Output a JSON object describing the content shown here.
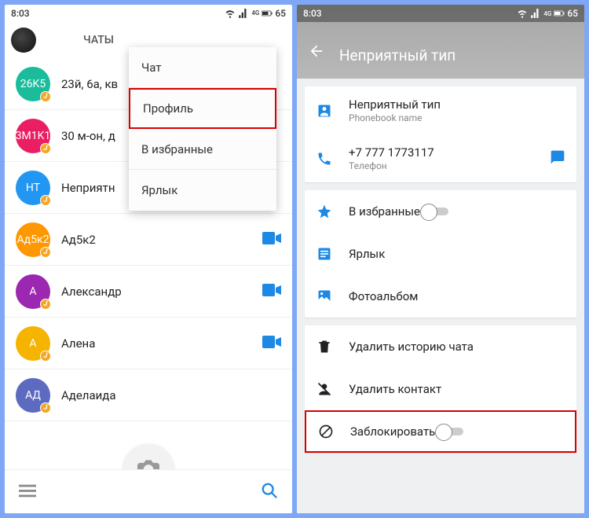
{
  "status": {
    "time": "8:03",
    "net": "4G",
    "battery": "65"
  },
  "left": {
    "tabs": {
      "chats": "ЧАТЫ"
    },
    "contacts": [
      {
        "initials": "26K5",
        "color": "c-teal",
        "name": "23й, 6а, кв",
        "cam": false
      },
      {
        "initials": "3M1K1",
        "color": "c-pink",
        "name": "30 м-он, д",
        "cam": false
      },
      {
        "initials": "НТ",
        "color": "c-blue",
        "name": "Неприятн",
        "cam": false
      },
      {
        "initials": "Ад5к2",
        "color": "c-orange",
        "name": "Ад5к2",
        "cam": true
      },
      {
        "initials": "А",
        "color": "c-purple",
        "name": "Александр",
        "cam": true
      },
      {
        "initials": "А",
        "color": "c-yellow",
        "name": "Алена",
        "cam": true
      },
      {
        "initials": "АД",
        "color": "c-indigo",
        "name": "Аделаида",
        "cam": false
      }
    ],
    "menu": {
      "chat": "Чат",
      "profile": "Профиль",
      "fav": "В избранные",
      "shortcut": "Ярлык"
    }
  },
  "right": {
    "title": "Неприятный тип",
    "name_row": {
      "name": "Неприятный тип",
      "sub": "Phonebook name"
    },
    "phone_row": {
      "number": "+7 777 1773117",
      "sub": "Телефон"
    },
    "fav": "В избранные",
    "shortcut": "Ярлык",
    "album": "Фотоальбом",
    "del_history": "Удалить историю чата",
    "del_contact": "Удалить контакт",
    "block": "Заблокировать"
  }
}
